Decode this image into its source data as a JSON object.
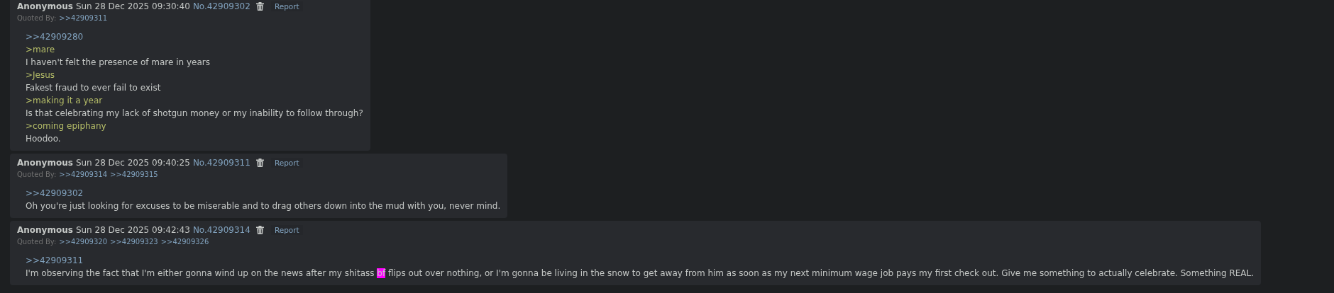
{
  "posts": [
    {
      "name": "Anonymous",
      "date": "Sun 28 Dec 2025 09:30:40",
      "number": "No.42909302",
      "report": "Report",
      "quoted_by_label": "Quoted By:",
      "quoted_by": [
        ">>42909311"
      ],
      "lines": [
        {
          "kind": "quotelink",
          "text": ">>42909280"
        },
        {
          "kind": "greentext",
          "text": ">mare"
        },
        {
          "kind": "text",
          "text": "I haven't felt the presence of mare in years"
        },
        {
          "kind": "greentext",
          "text": ">Jesus"
        },
        {
          "kind": "text",
          "text": "Fakest fraud to ever fail to exist"
        },
        {
          "kind": "greentext",
          "text": ">making it a year"
        },
        {
          "kind": "text",
          "text": "Is that celebrating my lack of shotgun money or my inability to follow through?"
        },
        {
          "kind": "greentext",
          "text": ">coming epiphany"
        },
        {
          "kind": "text",
          "text": "Hoodoo."
        }
      ]
    },
    {
      "name": "Anonymous",
      "date": "Sun 28 Dec 2025 09:40:25",
      "number": "No.42909311",
      "report": "Report",
      "quoted_by_label": "Quoted By:",
      "quoted_by": [
        ">>42909314",
        ">>42909315"
      ],
      "lines": [
        {
          "kind": "quotelink",
          "text": ">>42909302"
        },
        {
          "kind": "text",
          "text": "Oh you're just looking for excuses to be miserable and to drag others down into the mud with you, never mind."
        }
      ]
    },
    {
      "name": "Anonymous",
      "date": "Sun 28 Dec 2025 09:42:43",
      "number": "No.42909314",
      "report": "Report",
      "quoted_by_label": "Quoted By:",
      "quoted_by": [
        ">>42909320",
        ">>42909323",
        ">>42909326"
      ],
      "lines": [
        {
          "kind": "quotelink",
          "text": ">>42909311"
        },
        {
          "kind": "marked",
          "parts": [
            {
              "text": "I'm observing the fact that I'm either gonna wind up on the news after my shitass ",
              "highlighted": false
            },
            {
              "text": "bf",
              "highlighted": true
            },
            {
              "text": " flips out over nothing, or I'm gonna be living in the snow to get away from him as soon as my next minimum wage job pays my first check out. Give me something to actually celebrate. Something REAL.",
              "highlighted": false
            }
          ]
        }
      ]
    }
  ]
}
